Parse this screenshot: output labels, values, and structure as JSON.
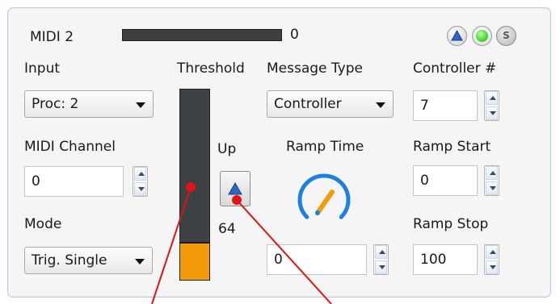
{
  "header": {
    "title": "MIDI 2",
    "meter_value": "0"
  },
  "status_icons": {
    "colors": {
      "up": "#2f66c4",
      "led": "#4cd23a",
      "solo": "#b5b5b5"
    },
    "solo_label": "S"
  },
  "input": {
    "label": "Input",
    "value": "Proc: 2"
  },
  "midi_channel": {
    "label": "MIDI Channel",
    "value": "0"
  },
  "mode": {
    "label": "Mode",
    "value": "Trig. Single"
  },
  "threshold": {
    "label": "Threshold",
    "value": "64",
    "direction_label": "Up",
    "fill_fraction": 0.2,
    "colors": {
      "track": "#3e4245",
      "fill": "#f39a0a"
    }
  },
  "message_type": {
    "label": "Message Type",
    "value": "Controller"
  },
  "ramp_time": {
    "label": "Ramp Time",
    "value": "0",
    "dial_color": "#1e7fe0",
    "needle_color": "#f39a0a"
  },
  "controller": {
    "label": "Controller #",
    "value": "7"
  },
  "ramp_start": {
    "label": "Ramp Start",
    "value": "0"
  },
  "ramp_stop": {
    "label": "Ramp Stop",
    "value": "100"
  },
  "annotation": {
    "arrow_color": "#e01414"
  }
}
